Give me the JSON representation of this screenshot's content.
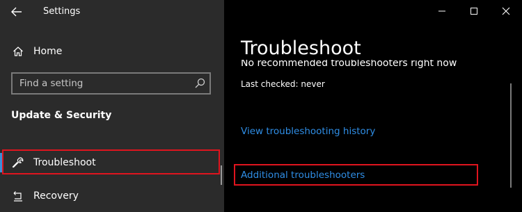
{
  "window": {
    "title": "Settings",
    "controls": {
      "minimize_icon": "minimize-icon",
      "maximize_icon": "maximize-icon",
      "close_icon": "close-icon"
    }
  },
  "sidebar": {
    "back_icon": "back-arrow-icon",
    "home": {
      "label": "Home",
      "icon": "home-icon"
    },
    "search": {
      "placeholder": "Find a setting",
      "value": "",
      "icon": "search-icon"
    },
    "section_heading": "Update & Security",
    "items": [
      {
        "label": "Troubleshoot",
        "icon": "wrench-icon",
        "selected": true
      },
      {
        "label": "Recovery",
        "icon": "recovery-icon",
        "selected": false
      }
    ]
  },
  "main": {
    "title": "Troubleshoot",
    "partially_hidden_text": "No recommended troubleshooters right now",
    "last_checked": "Last checked: never",
    "links": {
      "history": "View troubleshooting history",
      "additional": "Additional troubleshooters"
    }
  },
  "colors": {
    "sidebar_bg": "#2b2b2b",
    "main_bg": "#000000",
    "accent": "#2f8ee6",
    "highlight": "#e0141e"
  }
}
